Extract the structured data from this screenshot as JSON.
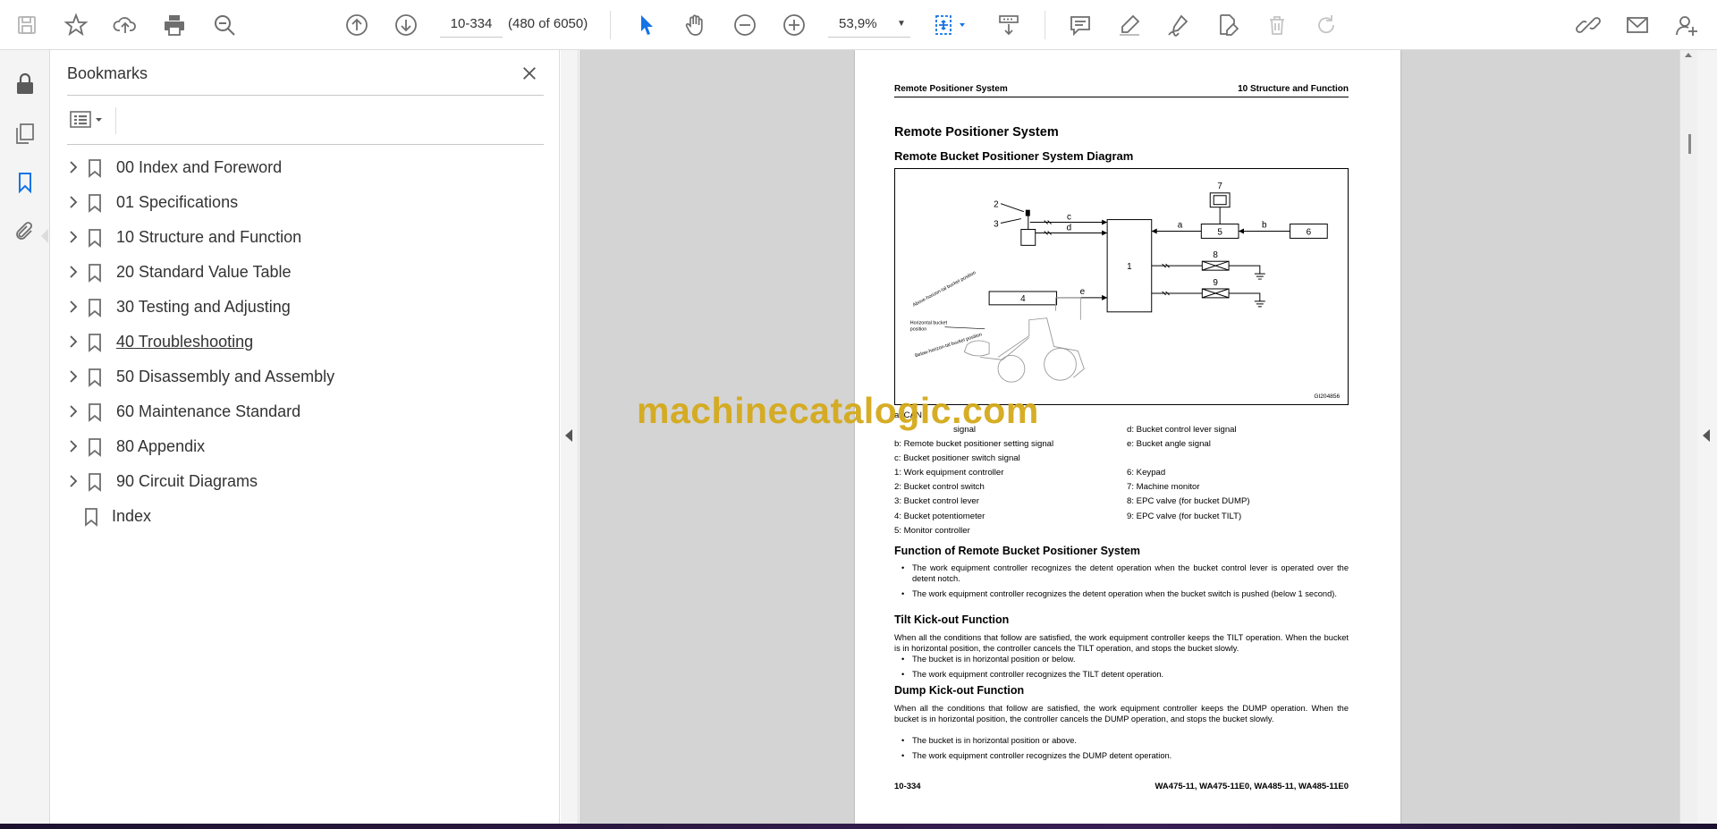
{
  "toolbar": {
    "page_value": "10-334",
    "page_count": "(480 of 6050)",
    "zoom": "53,9%"
  },
  "bookmarks": {
    "title": "Bookmarks",
    "items": [
      {
        "label": "00 Index and Foreword",
        "expandable": true
      },
      {
        "label": "01 Specifications",
        "expandable": true
      },
      {
        "label": "10 Structure and Function",
        "expandable": true
      },
      {
        "label": "20 Standard Value Table",
        "expandable": true
      },
      {
        "label": "30 Testing and Adjusting",
        "expandable": true
      },
      {
        "label": "40 Troubleshooting",
        "expandable": true,
        "hovered": true
      },
      {
        "label": "50 Disassembly and Assembly",
        "expandable": true
      },
      {
        "label": "60 Maintenance Standard",
        "expandable": true
      },
      {
        "label": "80 Appendix",
        "expandable": true
      },
      {
        "label": "90 Circuit Diagrams",
        "expandable": true
      },
      {
        "label": "Index",
        "expandable": false
      }
    ]
  },
  "doc": {
    "header_left": "Remote Positioner System",
    "header_right": "10 Structure and Function",
    "title": "Remote Positioner System",
    "subtitle": "Remote Bucket Positioner System Diagram",
    "diagram": {
      "labels": {
        "n1": "1",
        "n2": "2",
        "n3": "3",
        "n4": "4",
        "n5": "5",
        "n6": "6",
        "n7": "7",
        "n8": "8",
        "n9": "9",
        "a": "a",
        "b": "b",
        "c": "c",
        "d": "d",
        "e": "e"
      },
      "annot_above": "Above-horizon-tal bucket position",
      "annot_horizontal_1": "Horizontal bucket",
      "annot_horizontal_2": "position",
      "annot_below": "Below-horizon-tal bucket position",
      "code": "GI204856"
    },
    "legend": {
      "a_partial": "a: CAN",
      "a_end": "signal",
      "b": "b: Remote bucket positioner setting signal",
      "c": "c: Bucket positioner switch signal",
      "d": "d: Bucket control lever signal",
      "e": "e: Bucket angle signal",
      "l1": "1: Work equipment controller",
      "l2": "2: Bucket control switch",
      "l3": "3: Bucket control lever",
      "l4": "4: Bucket potentiometer",
      "l5": "5: Monitor controller",
      "l6": "6: Keypad",
      "l7": "7: Machine monitor",
      "l8": "8: EPC valve (for bucket DUMP)",
      "l9": "9: EPC valve (for bucket TILT)"
    },
    "sec_function": "Function of Remote Bucket Positioner System",
    "func_b1": "The work equipment controller recognizes the detent operation when the bucket control lever is operated over the detent notch.",
    "func_b2": "The work equipment controller recognizes the detent operation when the bucket switch is pushed (below 1 second).",
    "sec_tilt": "Tilt Kick-out Function",
    "tilt_para": "When all the conditions that follow are satisfied, the work equipment controller keeps the TILT operation. When the bucket is in horizontal position, the controller cancels the TILT operation, and stops the bucket slowly.",
    "tilt_b1": "The bucket is in horizontal position or below.",
    "tilt_b2": "The work equipment controller recognizes the TILT detent operation.",
    "sec_dump": "Dump Kick-out Function",
    "dump_para": "When all the conditions that follow are satisfied, the work equipment controller keeps the DUMP operation. When the bucket is in horizontal position, the controller cancels the DUMP operation, and stops the bucket slowly.",
    "dump_b1": "The bucket is in horizontal position or above.",
    "dump_b2": "The work equipment controller recognizes the DUMP detent operation.",
    "footer_left": "10-334",
    "footer_right": "WA475-11, WA475-11E0, WA485-11, WA485-11E0"
  },
  "watermark": "machinecatalogic.com",
  "colors": {
    "accent": "#1473e6",
    "watermark": "#d4a91a",
    "icon": "#6e6e6e"
  }
}
